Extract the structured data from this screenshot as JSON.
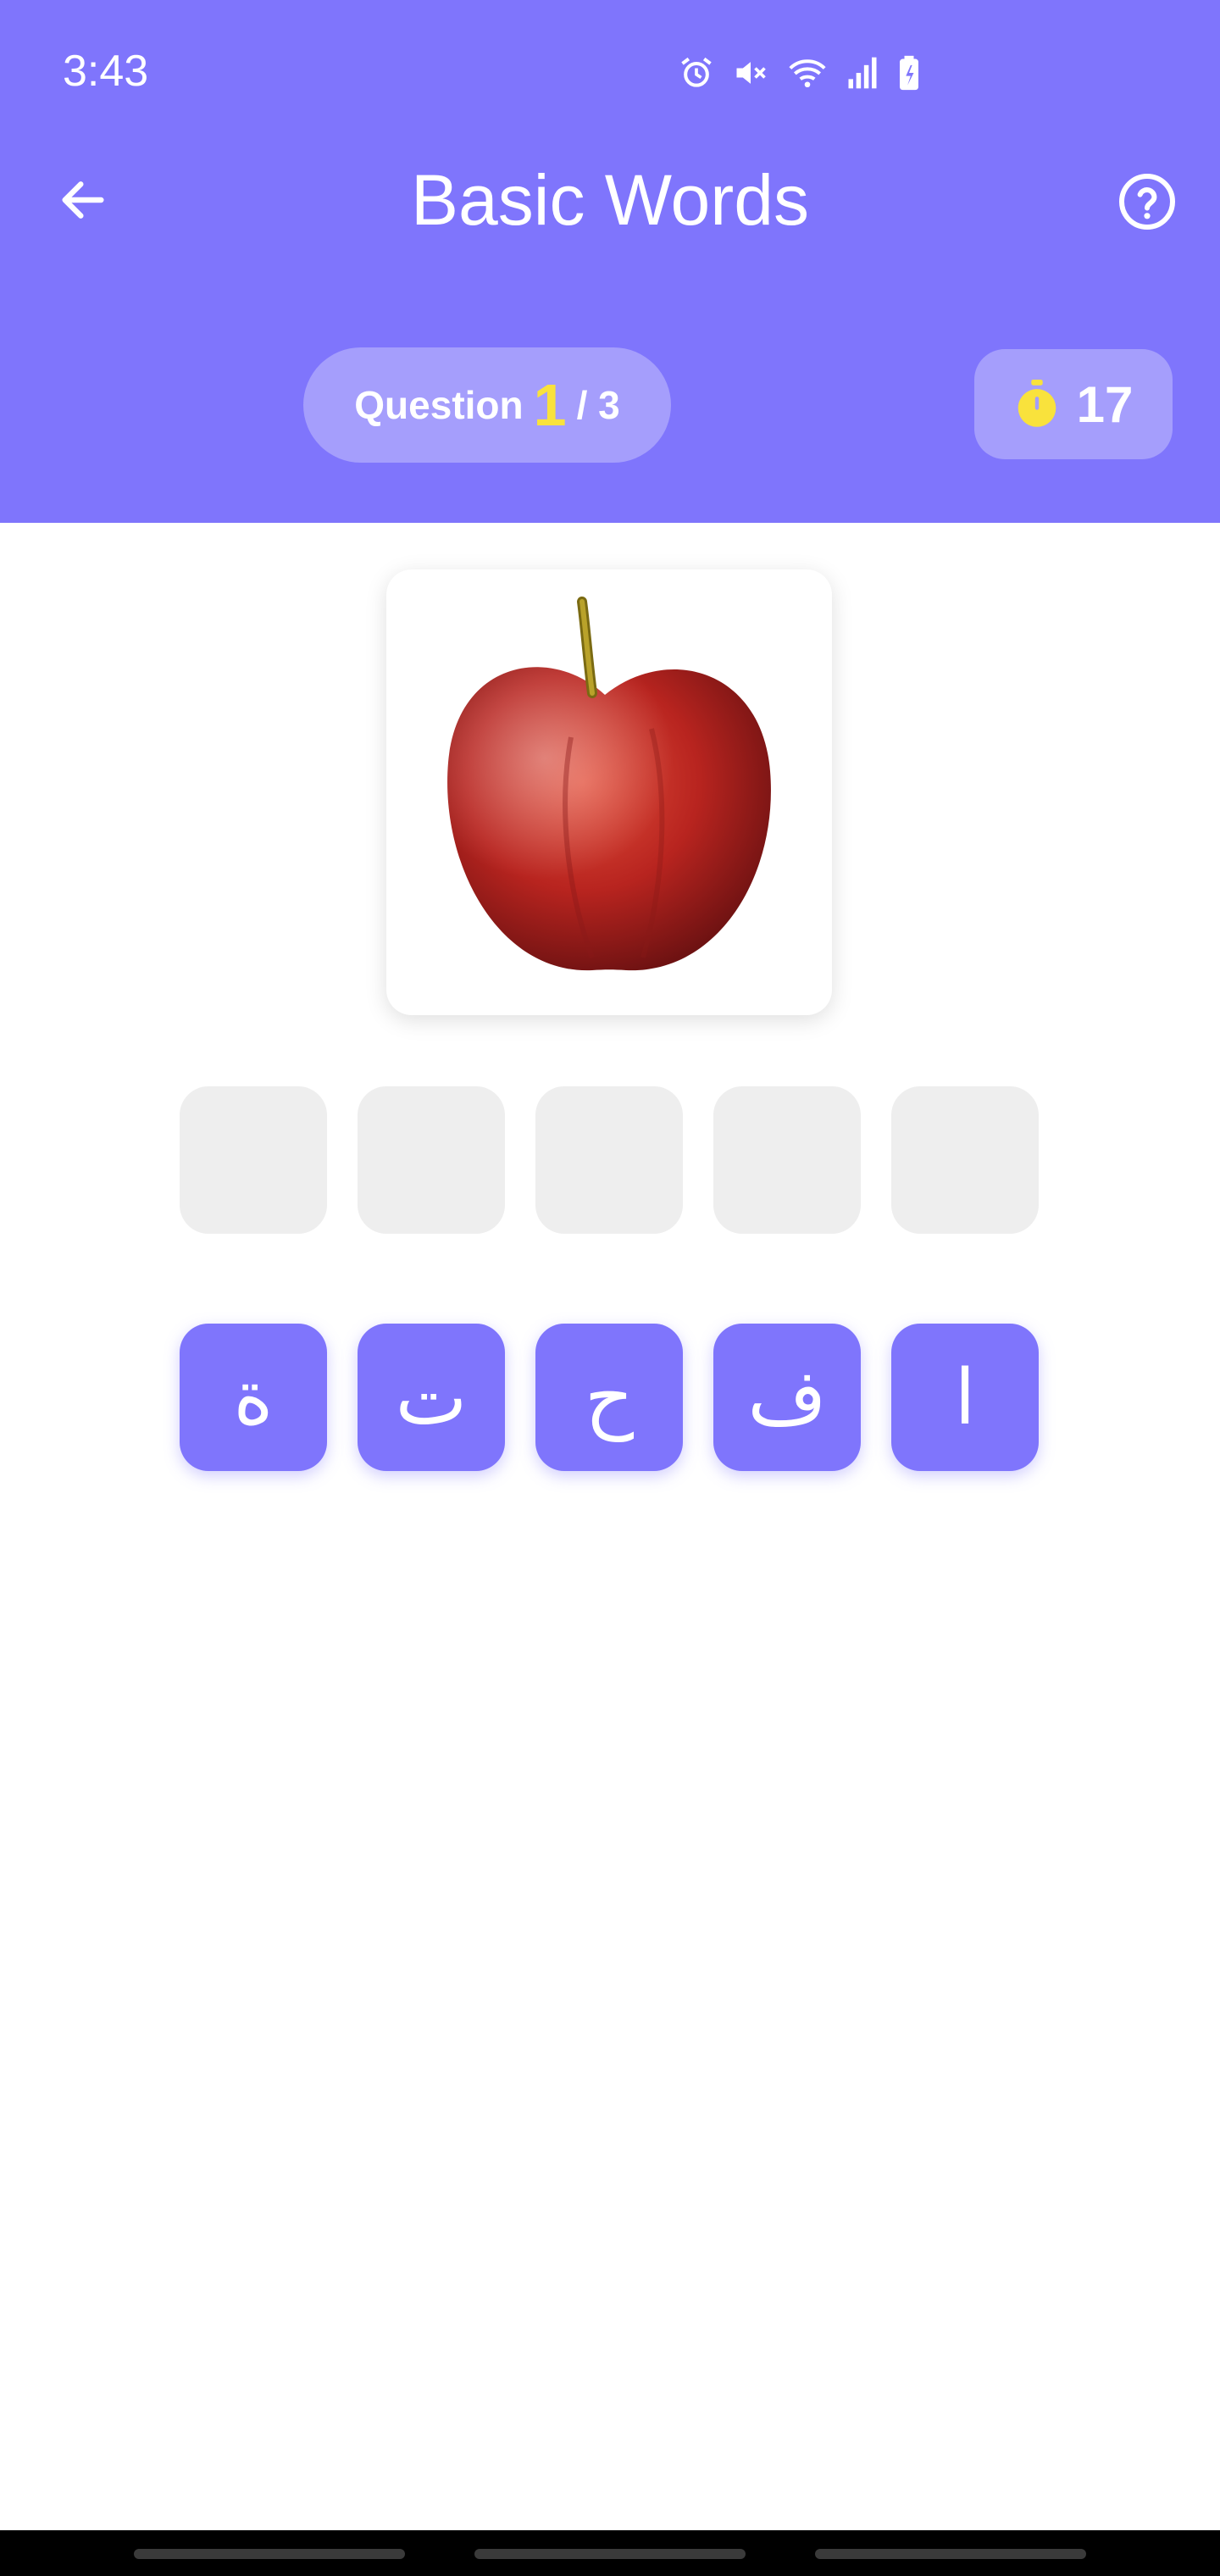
{
  "status_bar": {
    "time": "3:43",
    "icons": [
      "alarm-icon",
      "mute-icon",
      "wifi-icon",
      "signal-icon",
      "battery-icon"
    ]
  },
  "header": {
    "title": "Basic Words",
    "back_icon": "arrow-left-icon",
    "help_icon": "help-circle-icon"
  },
  "progress": {
    "label": "Question",
    "current": "1",
    "separator_total": "/ 3"
  },
  "timer": {
    "icon": "stopwatch-icon",
    "value": "17"
  },
  "image": {
    "subject": "apple"
  },
  "answer_slots": [
    "",
    "",
    "",
    "",
    ""
  ],
  "letter_tiles": [
    "ة",
    "ت",
    "ح",
    "ف",
    "ا"
  ],
  "colors": {
    "primary": "#7f75fc",
    "pill": "#a59efc",
    "highlight": "#f9e23c",
    "slot": "#eeeeee"
  }
}
